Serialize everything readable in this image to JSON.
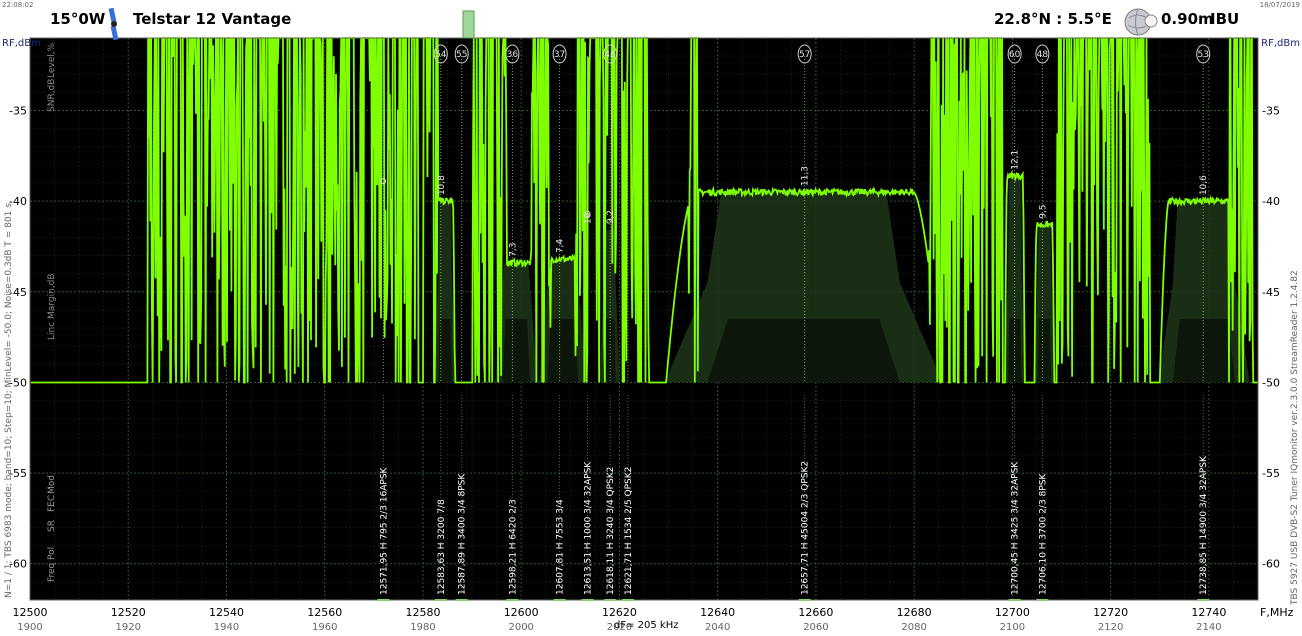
{
  "header": {
    "time": "22:08:02",
    "date": "18/07/2019",
    "satellite_pos": "15°0W",
    "satellite_name": "Telstar 12 Vantage",
    "location": "22.8°N : 5.5°E",
    "dish": "0.90m",
    "band": "IBU",
    "satellite_icon": "satellite-icon",
    "globe_icon": "globe-icon"
  },
  "footer": {
    "dF": "dF= 205 kHz",
    "f_unit": "F,MHz"
  },
  "side_texts": {
    "left": "N=1 / 1; TBS 6983 mode; band=10; Step=10; MinLevel= -50.0; Noise=0.3dB   T = 801 s",
    "right": "TBS 5927 USB DVB-S2 Tuner   IQmonitor  ver.2.3.0.0   StreamReader 1.2.4.82"
  },
  "chart_data": {
    "type": "line",
    "title": "Telstar 12 Vantage",
    "xlabel": "F,MHz",
    "ylabel": "RF,dBm",
    "xlim": [
      12500,
      12750
    ],
    "ylim": [
      -62,
      -31
    ],
    "x_ticks": [
      12500,
      12520,
      12540,
      12560,
      12580,
      12600,
      12620,
      12640,
      12660,
      12680,
      12700,
      12720,
      12740
    ],
    "x_ticks_if": [
      "1900",
      "1920",
      "1940",
      "1960",
      "1980",
      "2000",
      "2020",
      "2040",
      "2060",
      "2080",
      "2100",
      "2120",
      "2140"
    ],
    "y_ticks": [
      -35,
      -40,
      -45,
      -50,
      -55,
      -60
    ],
    "row_labels": [
      "Freq",
      "Pol",
      "SR",
      "FEC",
      "Mod"
    ],
    "left_axis_labels": [
      "Level,%",
      "SNR,dB",
      "Linc Margin,dB"
    ],
    "colors": {
      "line": "#7fff00",
      "bg": "#000000",
      "grid": "#2c5a2c",
      "fill": "#1d3318"
    },
    "channels": [
      {
        "num": "",
        "freq": "12571,95",
        "pol": "H",
        "sr": "795",
        "fec": "2/3",
        "mod": "16APSK",
        "snr": ""
      },
      {
        "num": "54",
        "freq": "12583,63",
        "pol": "H",
        "sr": "3200",
        "fec": "7/8",
        "mod": "",
        "snr": "10,8"
      },
      {
        "num": "55",
        "freq": "12587,89",
        "pol": "H",
        "sr": "3400",
        "fec": "3/4",
        "mod": "8PSK",
        "snr": ""
      },
      {
        "num": "36",
        "freq": "12598,21",
        "pol": "H",
        "sr": "6420",
        "fec": "2/3",
        "mod": "",
        "snr": "7,3"
      },
      {
        "num": "37",
        "freq": "12607,81",
        "pol": "H",
        "sr": "7553",
        "fec": "3/4",
        "mod": "",
        "snr": "7,4"
      },
      {
        "num": "",
        "freq": "12613,51",
        "pol": "H",
        "sr": "1000",
        "fec": "3/4",
        "mod": "32APSK",
        "snr": "10"
      },
      {
        "num": "46",
        "freq": "12618,11",
        "pol": "H",
        "sr": "3240",
        "fec": "3/4",
        "mod": "QPSK2",
        "snr": "9,2"
      },
      {
        "num": "",
        "freq": "12621,71",
        "pol": "H",
        "sr": "1534",
        "fec": "2/5",
        "mod": "QPSK2",
        "snr": ""
      },
      {
        "num": "57",
        "freq": "12657,71",
        "pol": "H",
        "sr": "45004",
        "fec": "2/3",
        "mod": "QPSK2",
        "snr": "11,3"
      },
      {
        "num": "60",
        "freq": "12700,45",
        "pol": "H",
        "sr": "3425",
        "fec": "3/4",
        "mod": "32APSK",
        "snr": "12,1"
      },
      {
        "num": "48",
        "freq": "12706,10",
        "pol": "H",
        "sr": "3700",
        "fec": "2/3",
        "mod": "8PSK",
        "snr": "9,5"
      },
      {
        "num": "53",
        "freq": "12738,85",
        "pol": "H",
        "sr": "14900",
        "fec": "3/4",
        "mod": "32APSK",
        "snr": "10,6"
      }
    ],
    "carriers": [
      {
        "f": 12584.5,
        "bw": 4.0,
        "level": -40.0
      },
      {
        "f": 12599.0,
        "bw": 8.0,
        "level": -43.4
      },
      {
        "f": 12608.5,
        "bw": 9.0,
        "level": -43.2
      },
      {
        "f": 12618.0,
        "bw": 3.5,
        "level": -41.6
      },
      {
        "f": 12657.5,
        "bw": 56.0,
        "level": -39.5
      },
      {
        "f": 12700.5,
        "bw": 4.0,
        "level": -38.6
      },
      {
        "f": 12706.5,
        "bw": 4.0,
        "level": -41.3
      },
      {
        "f": 12739.0,
        "bw": 18.0,
        "level": -40.0
      }
    ],
    "spike_regions": [
      [
        12524,
        12579
      ],
      [
        12580,
        12583
      ],
      [
        12590,
        12597
      ],
      [
        12602,
        12606
      ],
      [
        12611,
        12626
      ],
      [
        12634,
        12636
      ],
      [
        12683,
        12698
      ],
      [
        12709,
        12728
      ],
      [
        12744,
        12749
      ]
    ],
    "extra_markers": [
      {
        "f": 12571.9,
        "level": -38.9
      },
      {
        "f": 12613.5,
        "level": -40.7
      }
    ]
  }
}
